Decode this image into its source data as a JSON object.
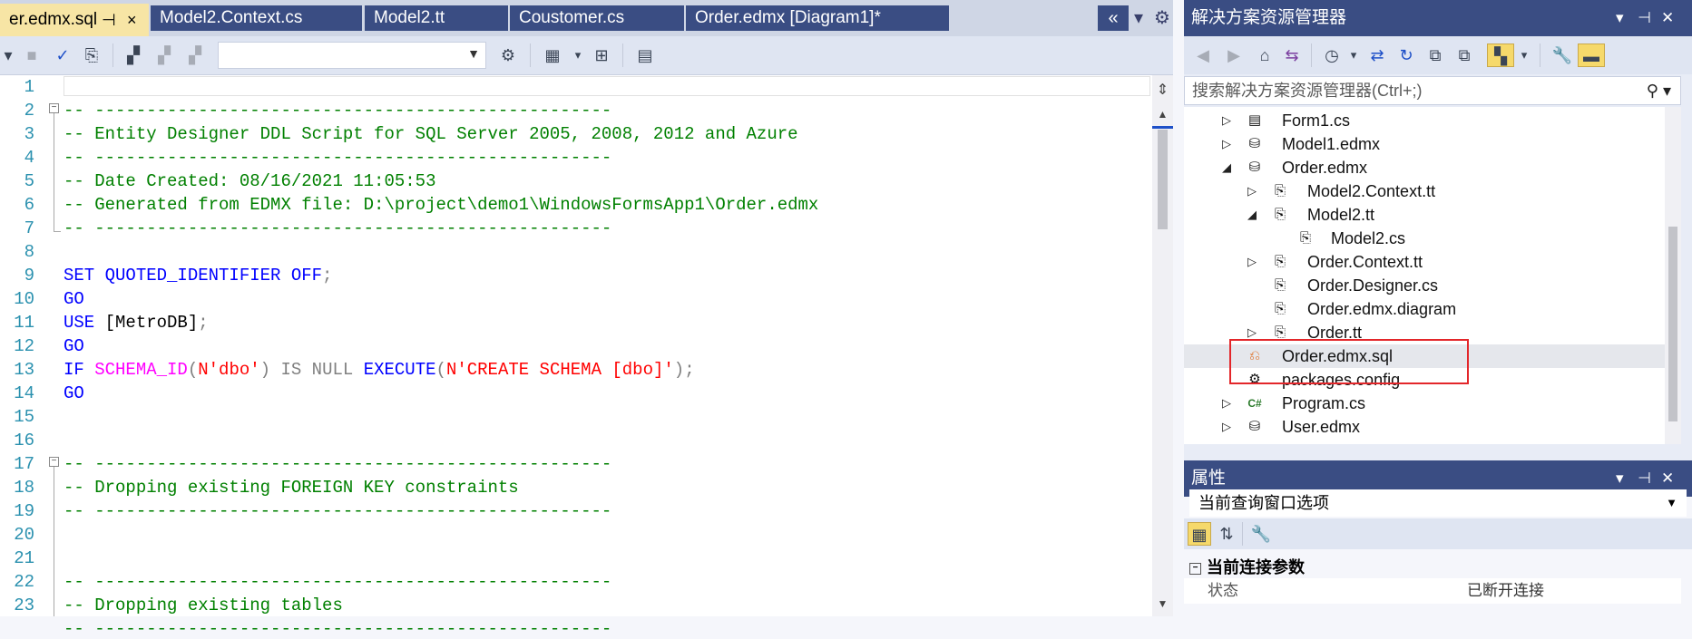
{
  "tabs": [
    {
      "label": "er.edmx.sql",
      "active": true
    },
    {
      "label": "Model2.Context.cs",
      "active": false
    },
    {
      "label": "Model2.tt",
      "active": false
    },
    {
      "label": "Coustomer.cs",
      "active": false
    },
    {
      "label": "Order.edmx [Diagram1]*",
      "active": false
    }
  ],
  "tab_controls": {
    "pin": "⊣",
    "close": "×",
    "overflow": "«",
    "dropdown": "▾",
    "settings": "⚙"
  },
  "editor": {
    "line_numbers": [
      "1",
      "2",
      "3",
      "4",
      "5",
      "6",
      "7",
      "8",
      "9",
      "10",
      "11",
      "12",
      "13",
      "14",
      "15",
      "16",
      "17",
      "18",
      "19",
      "20",
      "21",
      "22",
      "23"
    ],
    "lines": {
      "l2": "-- --------------------------------------------------",
      "l3": "-- Entity Designer DDL Script for SQL Server 2005, 2008, 2012 and Azure",
      "l4": "-- --------------------------------------------------",
      "l5": "-- Date Created: 08/16/2021 11:05:53",
      "l6": "-- Generated from EDMX file: D:\\project\\demo1\\WindowsFormsApp1\\Order.edmx",
      "l7": "-- --------------------------------------------------",
      "l9a": "SET QUOTED_IDENTIFIER OFF",
      "l9b": ";",
      "l10": "GO",
      "l11a": "USE ",
      "l11b": "[MetroDB]",
      "l11c": ";",
      "l12": "GO",
      "l13a": "IF ",
      "l13b": "SCHEMA_ID",
      "l13c": "(",
      "l13d": "N'dbo'",
      "l13e": ") IS NULL ",
      "l13f": "EXECUTE",
      "l13g": "(",
      "l13h": "N'CREATE SCHEMA ",
      "l13i": "[dbo]",
      "l13j": "'",
      "l13k": ");",
      "l14": "GO",
      "l16": "-- --------------------------------------------------",
      "l17": "-- Dropping existing FOREIGN KEY constraints",
      "l18": "-- --------------------------------------------------",
      "l21": "-- --------------------------------------------------",
      "l22": "-- Dropping existing tables",
      "l23": "-- --------------------------------------------------"
    }
  },
  "solution_explorer": {
    "title": "解决方案资源管理器",
    "search_placeholder": "搜索解决方案资源管理器(Ctrl+;)",
    "items": [
      {
        "label": "Form1.cs",
        "icon": "form-icon",
        "expander": "▷"
      },
      {
        "label": "Model1.edmx",
        "icon": "edmx-icon",
        "expander": "▷"
      },
      {
        "label": "Order.edmx",
        "icon": "edmx-icon",
        "expander": "◢"
      },
      {
        "label": "Model2.Context.tt",
        "icon": "tt-icon",
        "expander": "▷"
      },
      {
        "label": "Model2.tt",
        "icon": "tt-icon",
        "expander": "◢"
      },
      {
        "label": "Model2.cs",
        "icon": "tt-icon",
        "expander": ""
      },
      {
        "label": "Order.Context.tt",
        "icon": "tt-icon",
        "expander": "▷"
      },
      {
        "label": "Order.Designer.cs",
        "icon": "tt-icon",
        "expander": ""
      },
      {
        "label": "Order.edmx.diagram",
        "icon": "tt-icon",
        "expander": ""
      },
      {
        "label": "Order.tt",
        "icon": "tt-icon",
        "expander": "▷"
      },
      {
        "label": "Order.edmx.sql",
        "icon": "sql-file-icon",
        "expander": ""
      },
      {
        "label": "packages.config",
        "icon": "config-icon",
        "expander": ""
      },
      {
        "label": "Program.cs",
        "icon": "csharp-icon",
        "expander": "▷"
      },
      {
        "label": "User.edmx",
        "icon": "edmx-icon",
        "expander": "▷"
      }
    ]
  },
  "properties": {
    "title": "属性",
    "selector": "当前查询窗口选项",
    "category": "当前连接参数",
    "row_key": "状态",
    "row_value": "已断开连接"
  }
}
